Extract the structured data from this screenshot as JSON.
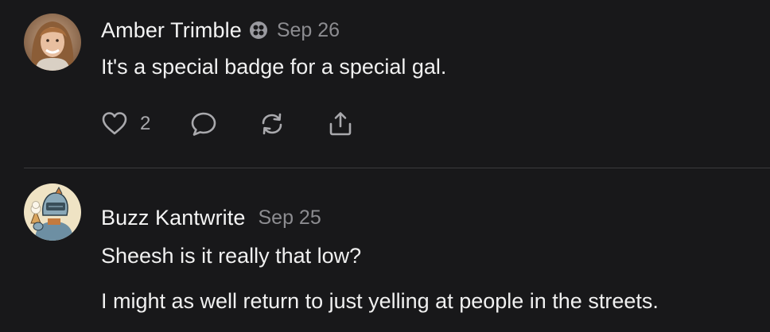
{
  "posts": [
    {
      "author": "Amber Trimble",
      "badge_icon": "flower-badge-icon",
      "date": "Sep 26",
      "lines": [
        "It's a special badge for a special gal."
      ],
      "actions": {
        "like_icon": "heart-icon",
        "like_count": "2",
        "reply_icon": "comment-icon",
        "repost_icon": "repost-icon",
        "share_icon": "share-icon"
      }
    },
    {
      "author": "Buzz Kantwrite",
      "date": "Sep 25",
      "lines": [
        "Sheesh is it really that low?",
        "I might as well return to just yelling at people in the streets."
      ]
    }
  ],
  "colors": {
    "background": "#18181a",
    "text_primary": "#f2f2f2",
    "text_secondary": "#8c8c90",
    "icon": "#a9a9ad",
    "divider": "#3a3a3d"
  }
}
